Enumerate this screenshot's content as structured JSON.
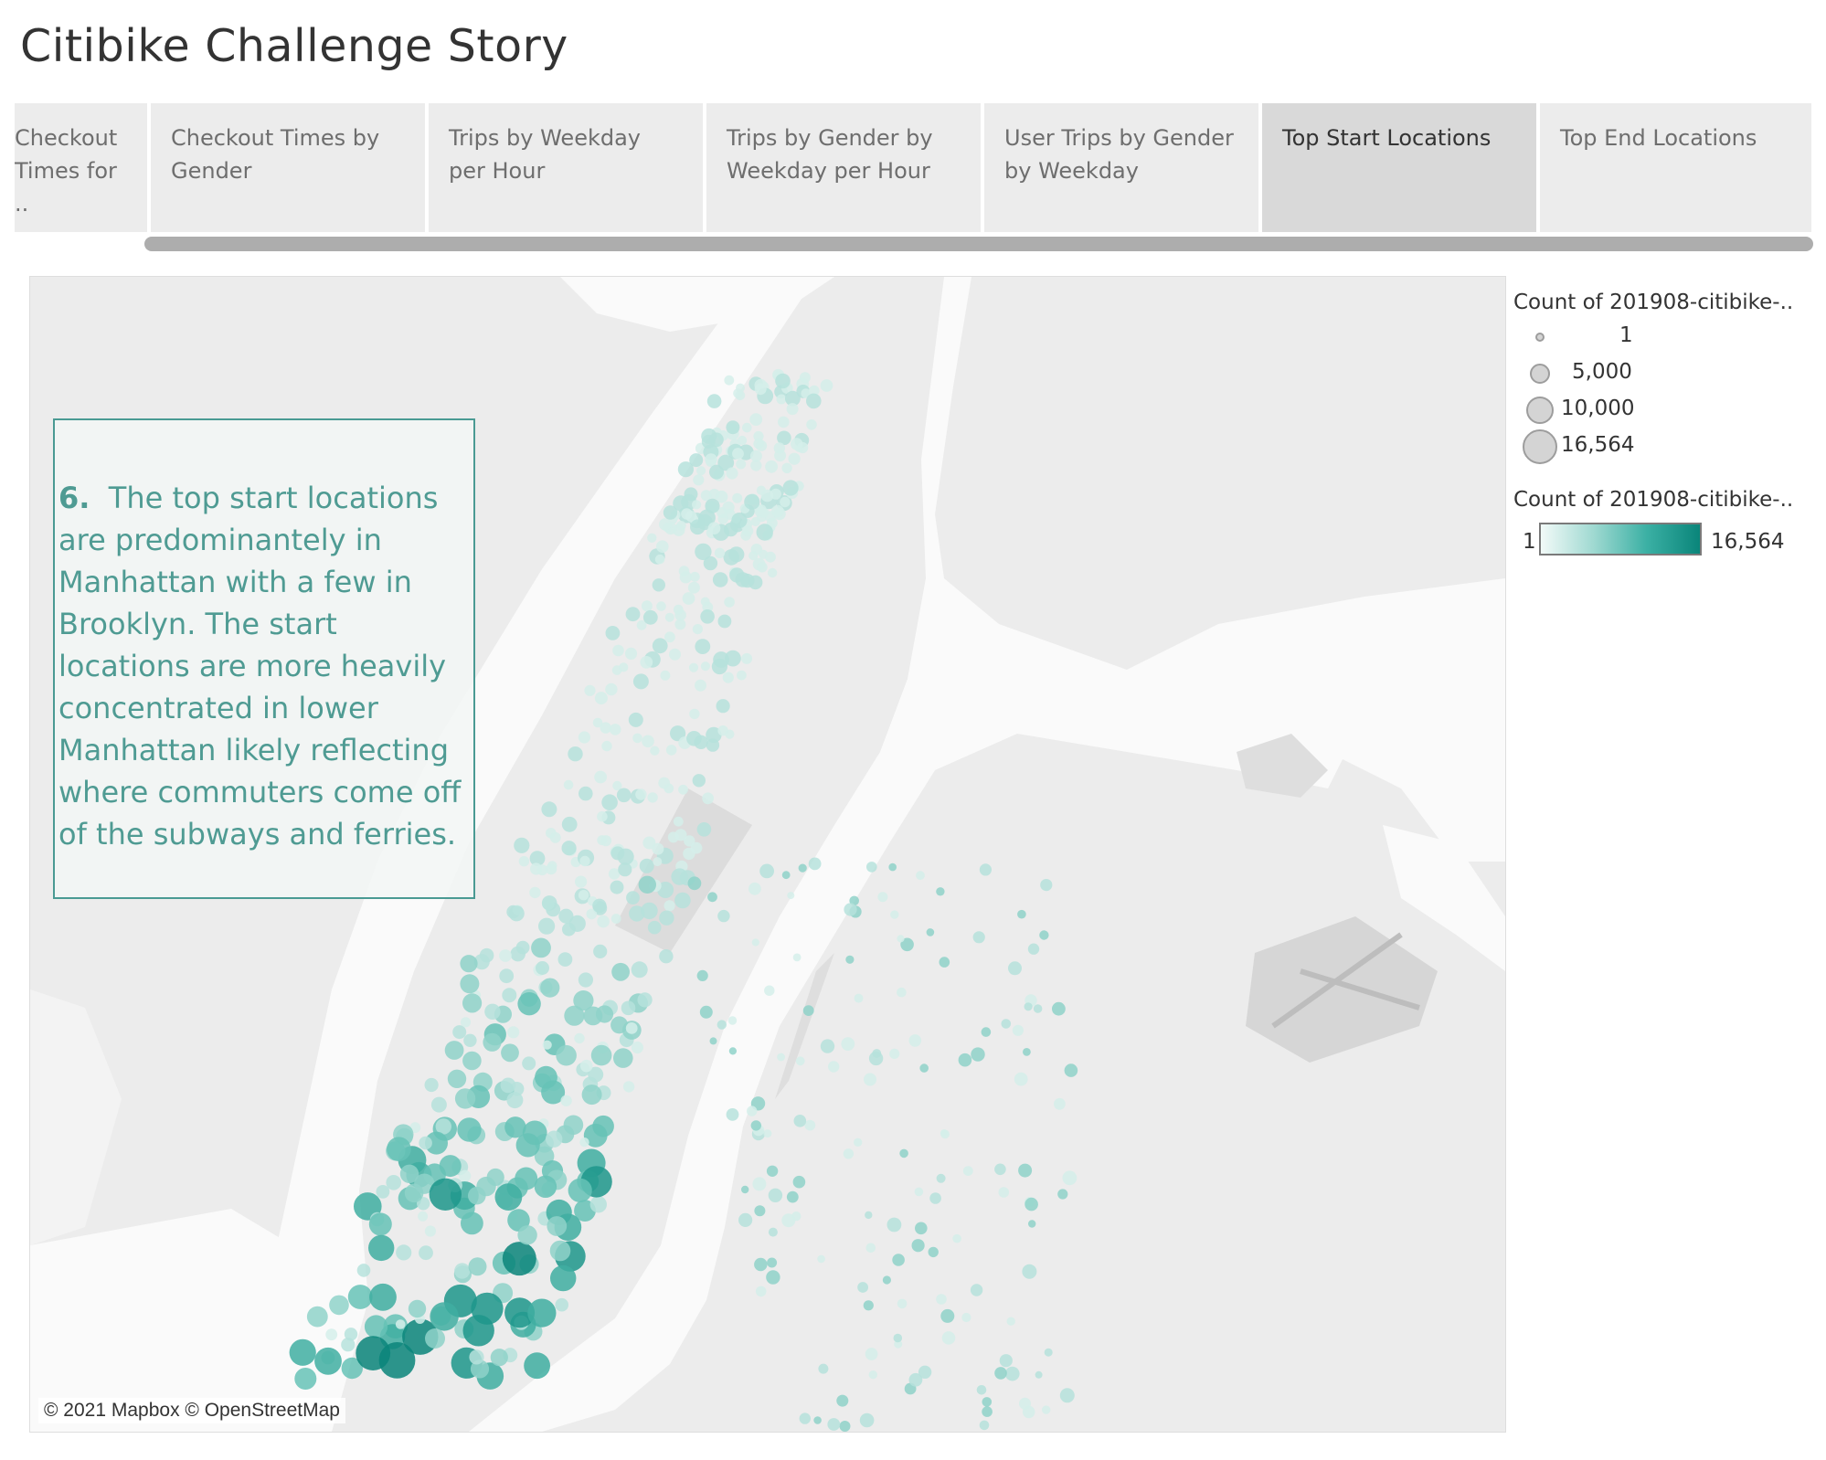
{
  "title": "Citibike Challenge Story",
  "tabs": [
    {
      "label": "Checkout Times for ..",
      "active": false
    },
    {
      "label": "Checkout Times by Gender",
      "active": false
    },
    {
      "label": "Trips by Weekday per Hour",
      "active": false
    },
    {
      "label": "Trips by Gender by Weekday per Hour",
      "active": false
    },
    {
      "label": "User Trips by Gender by Weekday",
      "active": false
    },
    {
      "label": "Top Start Locations",
      "active": true
    },
    {
      "label": "Top End Locations",
      "active": false
    }
  ],
  "caption": {
    "number": "6.",
    "text": "The top start locations are predominantely in Manhattan with a few in Brooklyn.  The start locations are more heavily concentrated in lower Manhattan likely reflecting where commuters come off of the subways and ferries."
  },
  "attribution": "© 2021 Mapbox © OpenStreetMap",
  "legend": {
    "size_title": "Count of 201908-citibike-..",
    "size_entries": [
      {
        "label": "1",
        "value": 1
      },
      {
        "label": "5,000",
        "value": 5000
      },
      {
        "label": "10,000",
        "value": 10000
      },
      {
        "label": "16,564",
        "value": 16564
      }
    ],
    "color_title": "Count of 201908-citibike-..",
    "color_min_label": "1",
    "color_max_label": "16,564",
    "color_scale": [
      "#f2faf8",
      "#9fd9d1",
      "#3bb0a4",
      "#0a857a"
    ]
  },
  "colors": {
    "land": "#ececec",
    "water": "#fafafa",
    "park": "#dcdcdc",
    "accent": "#4a9a93"
  }
}
